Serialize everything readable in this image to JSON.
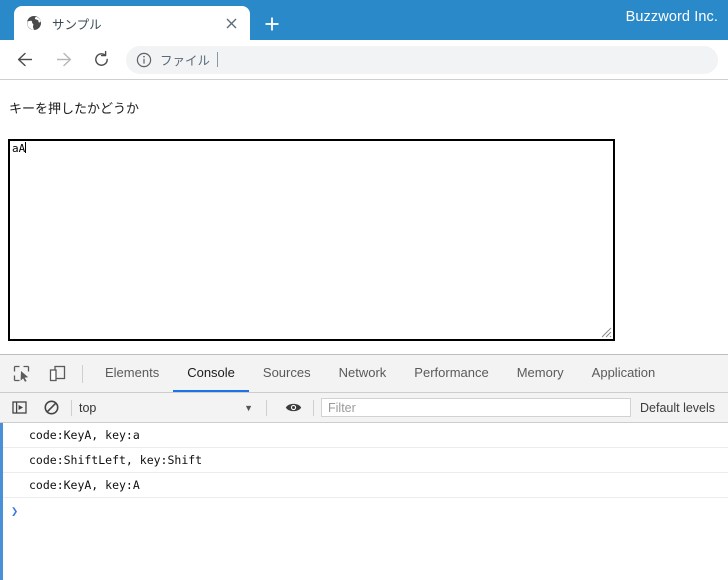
{
  "browser": {
    "brand": "Buzzword Inc.",
    "tab": {
      "title": "サンプル",
      "favicon_icon": "globe-icon",
      "close_label": "✕"
    },
    "newtab_label": "+",
    "nav": {
      "back_icon": "arrow-left-icon",
      "forward_icon": "arrow-right-icon",
      "reload_icon": "reload-icon"
    },
    "omnibox": {
      "info_icon": "info-circle-icon",
      "text": "ファイル"
    }
  },
  "page": {
    "label": "キーを押したかどうか",
    "textarea": {
      "value": "aA",
      "resize_handle_icon": "resize-grip-icon"
    }
  },
  "devtools": {
    "inspect_icon": "inspect-cursor-icon",
    "device_toggle_icon": "device-toolbar-icon",
    "tabs": [
      {
        "label": "Elements",
        "active": false
      },
      {
        "label": "Console",
        "active": true
      },
      {
        "label": "Sources",
        "active": false
      },
      {
        "label": "Network",
        "active": false
      },
      {
        "label": "Performance",
        "active": false
      },
      {
        "label": "Memory",
        "active": false
      },
      {
        "label": "Application",
        "active": false
      }
    ],
    "console_toolbar": {
      "sidebar_icon": "show-console-sidebar-icon",
      "clear_icon": "clear-console-icon",
      "context": "top",
      "context_arrow": "▼",
      "eye_icon": "live-expression-eye-icon",
      "filter_placeholder": "Filter",
      "levels": "Default levels"
    },
    "console_messages": [
      "code:KeyA, key:a",
      "code:ShiftLeft, key:Shift",
      "code:KeyA, key:A"
    ],
    "prompt_caret": "❯"
  },
  "colors": {
    "window_blue": "#2a89c8",
    "tab_active_underline": "#1a73e8",
    "console_left_rail": "#4a90d9"
  }
}
